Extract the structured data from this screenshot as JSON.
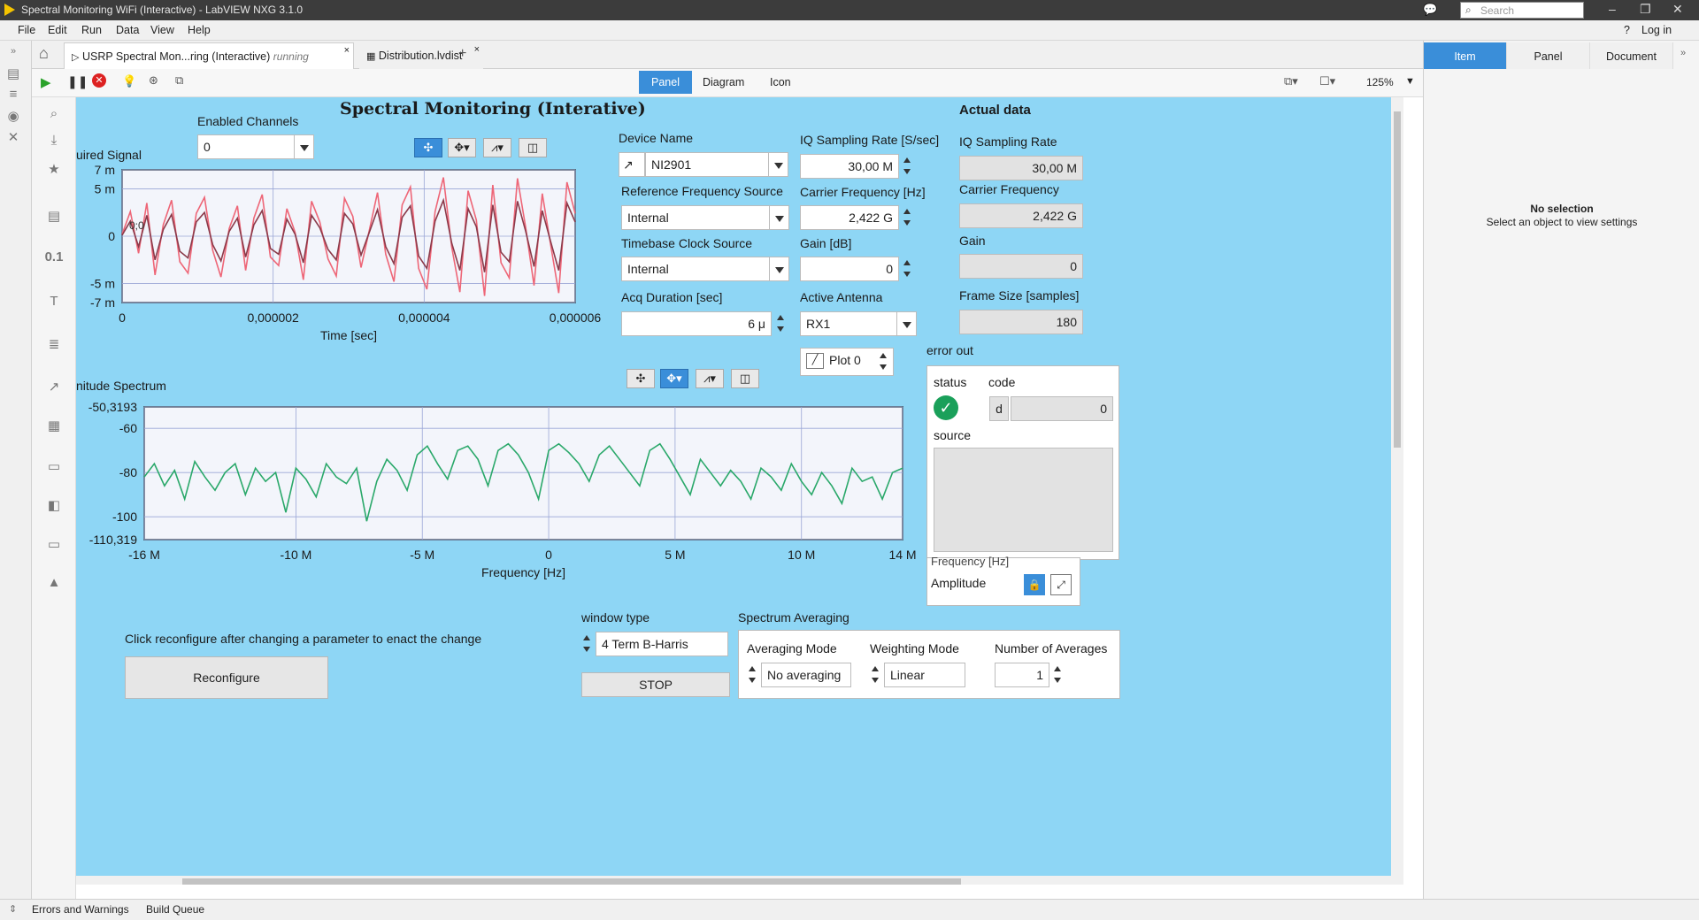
{
  "window": {
    "title": "Spectral Monitoring WiFi (Interactive) - LabVIEW NXG 3.1.0",
    "search_placeholder": "Search",
    "login": "Log in"
  },
  "menu": [
    "File",
    "Edit",
    "Run",
    "Data",
    "View",
    "Help"
  ],
  "tabs": [
    {
      "label": "USRP Spectral Mon...ring (Interactive)",
      "state": "running"
    },
    {
      "label": "Distribution.lvdist"
    }
  ],
  "view_tabs": [
    "Panel",
    "Diagram",
    "Icon"
  ],
  "zoom": "125%",
  "right_panel": {
    "tabs": [
      "Item",
      "Panel",
      "Document"
    ],
    "heading": "No selection",
    "message": "Select an object to view settings"
  },
  "bottom": {
    "errors": "Errors and Warnings",
    "queue": "Build Queue"
  },
  "panel": {
    "title": "Spectral Monitoring (Interative)",
    "enabled_channels": {
      "label": "Enabled Channels",
      "value": "0"
    },
    "device_name": {
      "label": "Device Name",
      "value": "NI2901"
    },
    "ref_freq_source": {
      "label": "Reference Frequency Source",
      "value": "Internal"
    },
    "timebase_source": {
      "label": "Timebase Clock Source",
      "value": "Internal"
    },
    "acq_duration": {
      "label": "Acq Duration [sec]",
      "value": "6 μ"
    },
    "iq_rate": {
      "label": "IQ Sampling Rate [S/sec]",
      "value": "30,00 M"
    },
    "carrier": {
      "label": "Carrier Frequency [Hz]",
      "value": "2,422 G"
    },
    "gain": {
      "label": "Gain [dB]",
      "value": "0"
    },
    "antenna": {
      "label": "Active Antenna",
      "value": "RX1"
    },
    "plot_legend": "Plot 0",
    "actual": {
      "heading": "Actual data",
      "iq_label": "IQ Sampling Rate",
      "iq_value": "30,00 M",
      "carrier_label": "Carrier Frequency",
      "carrier_value": "2,422 G",
      "gain_label": "Gain",
      "gain_value": "0",
      "frame_label": "Frame Size [samples]",
      "frame_value": "180"
    },
    "error_out": {
      "label": "error out",
      "status": "status",
      "code": "code",
      "code_prefix": "d",
      "code_value": "0",
      "source": "source"
    },
    "scale_legend": {
      "freq": "Frequency [Hz]",
      "amp": "Amplitude"
    },
    "hint": "Click reconfigure after changing a parameter to enact the change",
    "reconfigure": "Reconfigure",
    "window_type": {
      "label": "window type",
      "value": "4 Term B-Harris"
    },
    "stop": "STOP",
    "spectrum_avg": {
      "label": "Spectrum Averaging",
      "avg_mode_label": "Averaging Mode",
      "avg_mode": "No averaging",
      "weight_label": "Weighting Mode",
      "weight": "Linear",
      "num_label": "Number of Averages",
      "num": "1"
    }
  },
  "chart_data": [
    {
      "type": "line",
      "title": "uired Signal",
      "xlabel": "Time [sec]",
      "ylabel": "",
      "xlim": [
        0,
        6e-06
      ],
      "ylim": [
        -7,
        7
      ],
      "x_ticks": [
        "0",
        "0,000002",
        "0,000004",
        "0,000006"
      ],
      "y_ticks": [
        "7 m",
        "5 m",
        "0",
        "-5 m",
        "-7 m"
      ],
      "annotation": "0;0",
      "series": [
        {
          "color": "#ee6677",
          "values": [
            0.2,
            2.6,
            -1.8,
            3.5,
            -4.1,
            1.2,
            3.8,
            -2.7,
            -3.9,
            2.4,
            4.1,
            -1.5,
            -4.3,
            0.8,
            3.2,
            -3.6,
            1.9,
            4.4,
            -2.2,
            -3.1,
            2.9,
            0.4,
            -4.6,
            3.7,
            1.5,
            -2.4,
            -4.2,
            4.0,
            2.1,
            -3.3,
            0.6,
            4.6,
            -1.9,
            -4.8,
            3.3,
            5.2,
            -3.4,
            -5.6,
            2.6,
            6.2,
            -1.1,
            -5.9,
            4.8,
            1.7,
            -6.3,
            5.4,
            -2.8,
            -4.4,
            6.1,
            0.9,
            -5.2,
            4.5,
            -0.8,
            -6.0,
            5.7,
            2.4
          ]
        },
        {
          "color": "#8b3a4a",
          "values": [
            0.1,
            1.6,
            -1.1,
            2.2,
            -2.5,
            0.7,
            2.3,
            -1.6,
            -2.3,
            1.5,
            2.5,
            -0.9,
            -2.6,
            0.5,
            1.9,
            -2.2,
            1.2,
            2.7,
            -1.3,
            -1.9,
            1.8,
            0.2,
            -2.8,
            2.2,
            0.9,
            -1.4,
            -2.5,
            2.4,
            1.3,
            -2.0,
            0.4,
            2.8,
            -1.1,
            -2.9,
            2.0,
            3.2,
            -2.1,
            -3.4,
            1.6,
            3.8,
            -0.7,
            -3.6,
            2.9,
            1.0,
            -3.8,
            3.3,
            -1.7,
            -2.7,
            3.7,
            0.5,
            -3.2,
            2.7,
            -0.5,
            -3.6,
            3.5,
            1.5
          ]
        }
      ]
    },
    {
      "type": "line",
      "title": "nitude Spectrum",
      "xlabel": "Frequency [Hz]",
      "ylabel": "",
      "xlim": [
        -16000000,
        14000000
      ],
      "ylim": [
        -110.319,
        -50.3193
      ],
      "x_ticks": [
        "-16 M",
        "-10 M",
        "-5 M",
        "0",
        "5 M",
        "10 M",
        "14 M"
      ],
      "y_ticks": [
        "-50,3193",
        "-60",
        "-80",
        "-100",
        "-110,319"
      ],
      "series": [
        {
          "color": "#2aa86a",
          "values": [
            -82,
            -76,
            -86,
            -79,
            -92,
            -75,
            -82,
            -88,
            -80,
            -76,
            -90,
            -78,
            -84,
            -80,
            -98,
            -78,
            -83,
            -91,
            -76,
            -82,
            -85,
            -78,
            -102,
            -84,
            -74,
            -79,
            -88,
            -72,
            -68,
            -76,
            -83,
            -70,
            -68,
            -74,
            -86,
            -70,
            -67,
            -72,
            -80,
            -92,
            -70,
            -67,
            -71,
            -76,
            -84,
            -72,
            -68,
            -74,
            -80,
            -86,
            -70,
            -67,
            -74,
            -82,
            -90,
            -74,
            -80,
            -86,
            -79,
            -84,
            -92,
            -78,
            -82,
            -88,
            -76,
            -84,
            -90,
            -80,
            -86,
            -94,
            -78,
            -84,
            -82,
            -92,
            -80,
            -78
          ]
        }
      ]
    }
  ]
}
